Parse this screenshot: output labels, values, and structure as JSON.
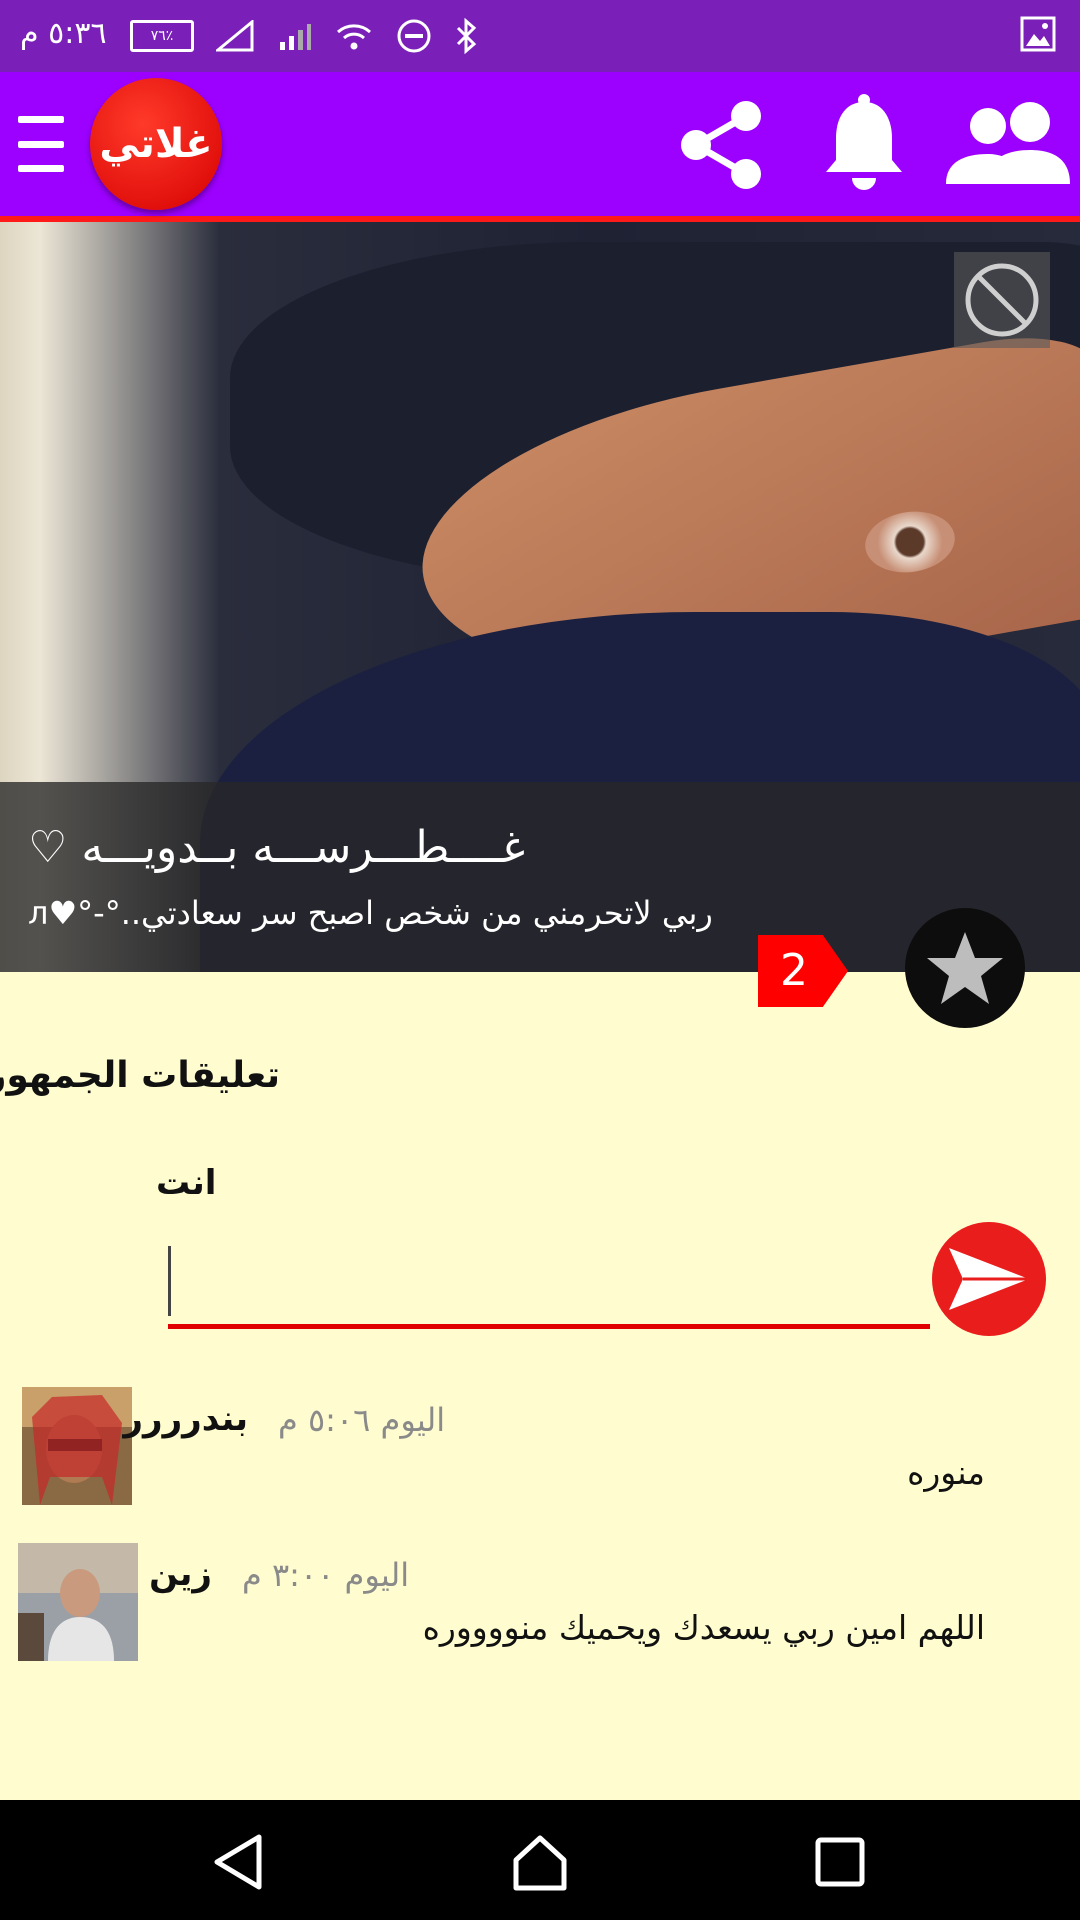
{
  "status_bar": {
    "time": "٥:٣٦ م",
    "battery": "٧٦٪"
  },
  "app_bar": {
    "logo_text": "غلاتي",
    "icons": [
      "menu-icon",
      "share-icon",
      "bell-icon",
      "people-icon"
    ]
  },
  "profile": {
    "name": "غــــطـــرســـه بــدويـــه ♡",
    "status": "ربي لاتحرمني من شخص اصبح سر سعادتي..°-°♥ᴫ"
  },
  "rating": {
    "count": "2"
  },
  "comments_section": {
    "title": "تعليقات الجمهور",
    "me_label": "انت",
    "input_value": "",
    "input_placeholder": ""
  },
  "comments": [
    {
      "author": "بندرررر",
      "time": "اليوم ٥:٠٦ م",
      "text": "منوره"
    },
    {
      "author": "زين",
      "time": "اليوم ٣:٠٠ م",
      "text": "اللهم امين ربي يسعدك ويحميك منووووره"
    }
  ],
  "colors": {
    "status_bar": "#7a1fb8",
    "app_bar": "#9c00ff",
    "accent_red": "#ff0000",
    "background": "#fffdd0"
  }
}
